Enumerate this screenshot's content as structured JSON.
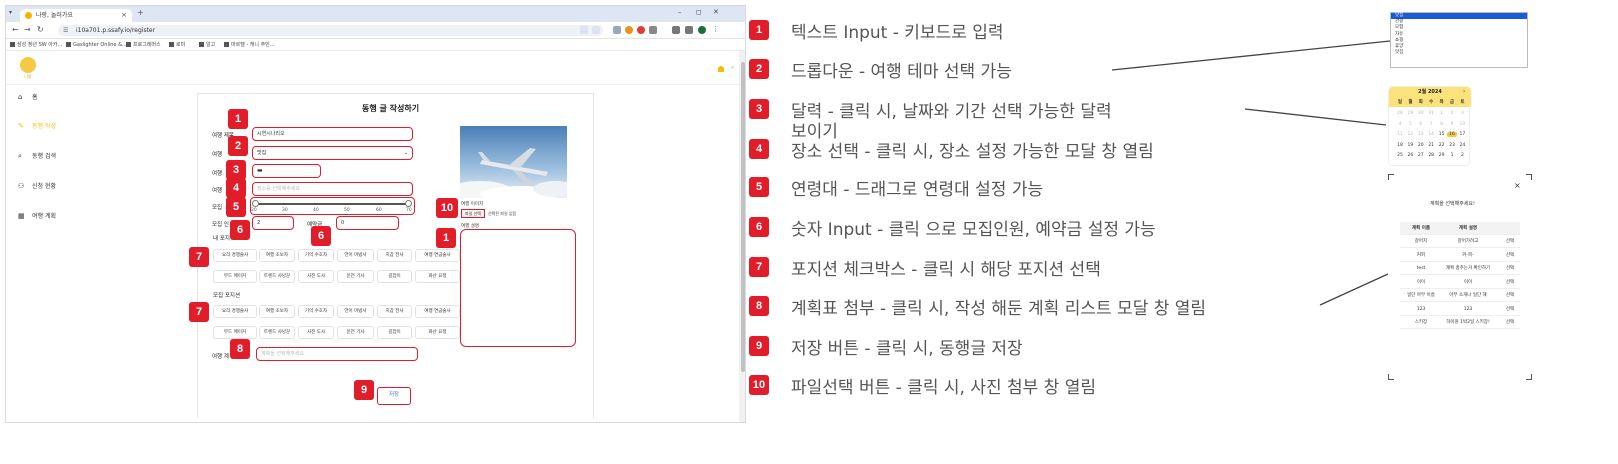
{
  "browser": {
    "tab_title": "나랑, 놀러가요",
    "tab_close": "×",
    "new_tab": "+",
    "win_min": "–",
    "win_max": "◻",
    "win_close": "✕",
    "url": "i10a701.p.ssafy.io/register",
    "bookmarks": [
      "삼성 청년 SW 아카...",
      "Gaslighter Online &...",
      "프로그래머스",
      "로미",
      "알고",
      "마르텔 - 캐니 주민..."
    ]
  },
  "header": {
    "logo_text": "나랑"
  },
  "sidebar": {
    "items": [
      {
        "icon": "⌂",
        "label": "홈"
      },
      {
        "icon": "✎",
        "label": "동행 작성"
      },
      {
        "icon": "⌕",
        "label": "동행 검색"
      },
      {
        "icon": "⚇",
        "label": "신청 현황"
      },
      {
        "icon": "▦",
        "label": "여행 계획"
      }
    ]
  },
  "form": {
    "title": "동행 글 작성하기",
    "title_label": "여행 제목",
    "title_value": "시연시나리오",
    "theme_label": "여행",
    "theme_value": "맛집",
    "date_label": "여행",
    "place_label": "여행",
    "place_placeholder": "장소를 선택해주세요",
    "age_label": "모집",
    "age_ticks": [
      "20",
      "30",
      "40",
      "50",
      "60",
      "70"
    ],
    "count_label": "모집 인",
    "count_value": "2",
    "deposit_label": "예약금",
    "deposit_value": "0",
    "my_position_label": "내 포지",
    "recruit_position_label": "모집 포지션",
    "positions": [
      "요리 경쟁술사",
      "여행 초보자",
      "기억 수호자",
      "언어 마법사",
      "지갑 전사",
      "여행 연금술사",
      "무드 메이커",
      "트렌드 사냥꾼",
      "사진 도사",
      "운전 기사",
      "길잡이",
      "화산 요정"
    ],
    "plan_label": "여행 계",
    "plan_placeholder": "계획을 선택해주세요",
    "image_label": "여행 이미지",
    "file_button": "파일 선택",
    "file_text": "선택된 파일 없음",
    "desc_label": "여행 설명",
    "save_label": "저장"
  },
  "badges": [
    "1",
    "2",
    "3",
    "4",
    "5",
    "6",
    "6",
    "7",
    "7",
    "8",
    "9",
    "10",
    "1"
  ],
  "legend": [
    {
      "num": "1",
      "text": "텍스트 Input - 키보드로 입력"
    },
    {
      "num": "2",
      "text": "드롭다운 - 여행 테마 선택 가능"
    },
    {
      "num": "3",
      "text": "달력 - 클릭 시, 날짜와 기간 선택 가능한 달력",
      "text2": "보이기"
    },
    {
      "num": "4",
      "text": "장소 선택 - 클릭 시, 장소 설정 가능한 모달 창 열림"
    },
    {
      "num": "5",
      "text": "연령대 - 드래그로 연령대 설정 가능"
    },
    {
      "num": "6",
      "text": "숫자 Input - 클릭 으로 모집인원, 예약금 설정 가능"
    },
    {
      "num": "7",
      "text": "포지션 체크박스 - 클릭 시 해당 포지션 선택"
    },
    {
      "num": "8",
      "text": "계획표 첨부 - 클릭 시, 작성 해둔 계획 리스트 모달 창 열림"
    },
    {
      "num": "9",
      "text": "저장 버튼 - 클릭 시, 동행글 저장"
    },
    {
      "num": "10",
      "text": "파일선택 버튼 - 클릭 시, 사진 첨부 창 열림"
    }
  ],
  "dropdown_preview": {
    "options": [
      "맛집",
      "관광",
      "모험",
      "자유",
      "쇼핑",
      "휴양",
      "맛집"
    ]
  },
  "calendar_preview": {
    "title": "2월 2024",
    "dow": [
      "일",
      "월",
      "화",
      "수",
      "목",
      "금",
      "토"
    ],
    "rows": [
      [
        "28",
        "29",
        "30",
        "31",
        "1",
        "2",
        "3"
      ],
      [
        "4",
        "5",
        "6",
        "7",
        "8",
        "9",
        "10"
      ],
      [
        "11",
        "12",
        "13",
        "14",
        "15",
        "16",
        "17"
      ],
      [
        "18",
        "19",
        "20",
        "21",
        "22",
        "23",
        "24"
      ],
      [
        "25",
        "26",
        "27",
        "28",
        "29",
        "1",
        "2"
      ]
    ],
    "today": "16"
  },
  "modal_preview": {
    "title": "계획을 선택해주세요!",
    "close": "×",
    "columns": [
      "계획 이름",
      "계획 설명",
      ""
    ],
    "rows": [
      [
        "갈어지",
        "갈어가려고",
        "선택"
      ],
      [
        "커피",
        "커-피-",
        "선택"
      ],
      [
        "test",
        "계획 총주는거 확인하기",
        "선택"
      ],
      [
        "이이",
        "이이",
        "선택"
      ],
      [
        "일단 아무 이름",
        "아무 소개나 일단 해",
        "선택"
      ],
      [
        "123",
        "123",
        "선택"
      ],
      [
        "스키장",
        "하이원 1박2일 스키장!",
        "선택"
      ]
    ]
  }
}
